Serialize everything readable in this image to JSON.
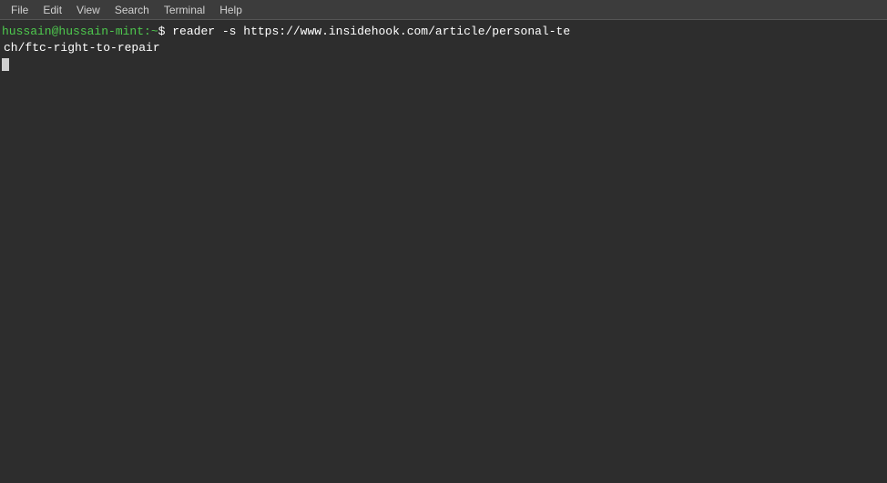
{
  "menubar": {
    "items": [
      "File",
      "Edit",
      "View",
      "Search",
      "Terminal",
      "Help"
    ]
  },
  "terminal": {
    "prompt_user": "hussain@hussain-mint",
    "prompt_path": ":~",
    "prompt_symbol": "$",
    "command_line1": " reader -s https://www.insidehook.com/article/personal-te",
    "command_line2": "ch/ftc-right-to-repair",
    "cursor_visible": true
  }
}
